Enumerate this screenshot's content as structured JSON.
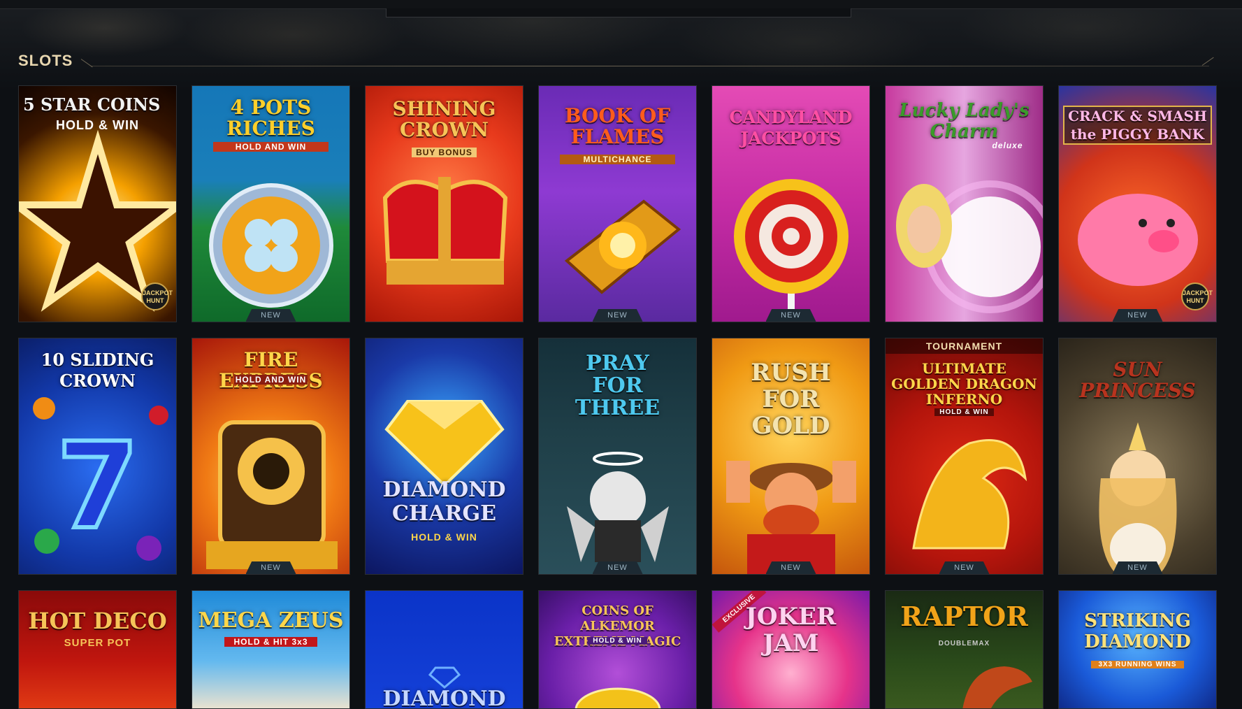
{
  "section": {
    "title": "SLOTS"
  },
  "new_badge": "NEW",
  "tiles": [
    {
      "title": "5 STAR COINS",
      "sub": "HOLD & WIN",
      "badge": false,
      "jackpot": "JACKPOT HUNT"
    },
    {
      "title": "4 POTS RICHES",
      "sub": "HOLD AND WIN",
      "badge": true
    },
    {
      "title": "SHINING CROWN",
      "sub": "BUY BONUS",
      "badge": false
    },
    {
      "title": "BOOK OF FLAMES",
      "sub": "MULTICHANCE",
      "badge": true
    },
    {
      "title": "CANDYLAND JACKPOTS",
      "sub": "",
      "badge": true
    },
    {
      "title": "Lucky Lady's Charm",
      "sub": "deluxe",
      "badge": false
    },
    {
      "title": "CRACK & SMASH the PIGGY BANK",
      "sub": "",
      "badge": true,
      "jackpot": "JACKPOT HUNT"
    },
    {
      "title": "10 SLIDING CROWN",
      "sub": "",
      "badge": false
    },
    {
      "title": "FIRE EXPRESS",
      "sub": "HOLD AND WIN",
      "badge": true
    },
    {
      "title": "DIAMOND CHARGE",
      "sub": "HOLD & WIN",
      "badge": false
    },
    {
      "title": "PRAY FOR THREE",
      "sub": "",
      "badge": true
    },
    {
      "title": "RUSH FOR GOLD",
      "sub": "",
      "badge": true
    },
    {
      "title": "ULTIMATE GOLDEN DRAGON INFERNO",
      "sub": "HOLD & WIN",
      "badge": true,
      "banner": "TOURNAMENT"
    },
    {
      "title": "SUN PRINCESS",
      "sub": "",
      "badge": true
    },
    {
      "title": "HOT DECO",
      "sub": "SUPER POT",
      "badge": false
    },
    {
      "title": "MEGA ZEUS",
      "sub": "HOLD & HIT 3x3",
      "badge": false
    },
    {
      "title": "DIAMOND",
      "sub": "",
      "badge": false
    },
    {
      "title": "COINS OF ALKEMOR EXTREME MAGIC",
      "sub": "HOLD & WIN",
      "badge": false
    },
    {
      "title": "JOKER JAM",
      "sub": "",
      "badge": false,
      "exclusive": "EXCLUSIVE"
    },
    {
      "title": "RAPTOR",
      "sub": "DOUBLEMAX",
      "badge": false
    },
    {
      "title": "STRIKING DIAMOND",
      "sub": "3X3 RUNNING WINS",
      "badge": false
    }
  ]
}
